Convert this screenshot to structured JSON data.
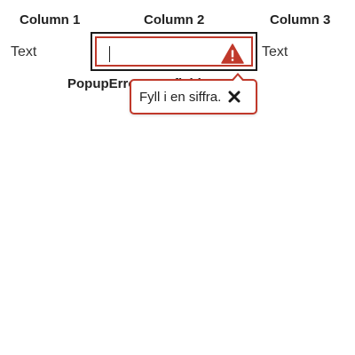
{
  "columns": [
    {
      "label": "Column 1"
    },
    {
      "label": "Column 2"
    },
    {
      "label": "Column 3"
    }
  ],
  "row": {
    "left_text": "Text",
    "right_text": "Text"
  },
  "field": {
    "value": "",
    "label": "PopupErrorInputfield",
    "error_color": "#c0392b",
    "icon": "warning-triangle-icon"
  },
  "popup": {
    "message": "Fyll i en siffra.",
    "close_icon": "close-icon"
  }
}
